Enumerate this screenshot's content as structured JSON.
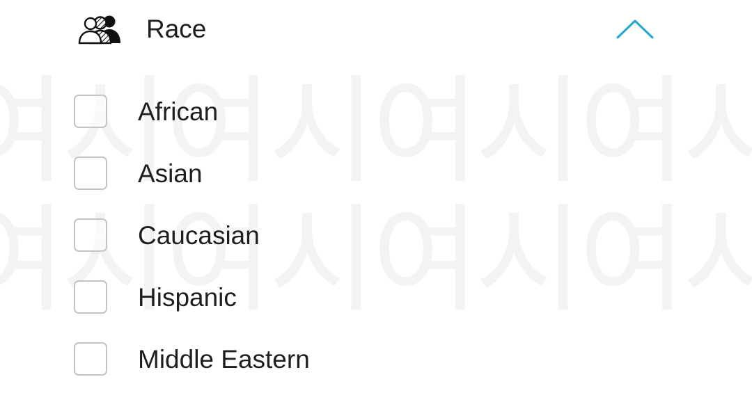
{
  "watermark": {
    "text_row_1": "여시여시여시여시",
    "text_row_2": "여시여시여시여시"
  },
  "filter": {
    "title": "Race",
    "icon": "people-group-icon",
    "toggle_icon": "chevron-up-icon",
    "accent_color": "#1ea7d6",
    "options": [
      {
        "label": "African",
        "checked": false
      },
      {
        "label": "Asian",
        "checked": false
      },
      {
        "label": "Caucasian",
        "checked": false
      },
      {
        "label": "Hispanic",
        "checked": false
      },
      {
        "label": "Middle Eastern",
        "checked": false
      }
    ]
  }
}
